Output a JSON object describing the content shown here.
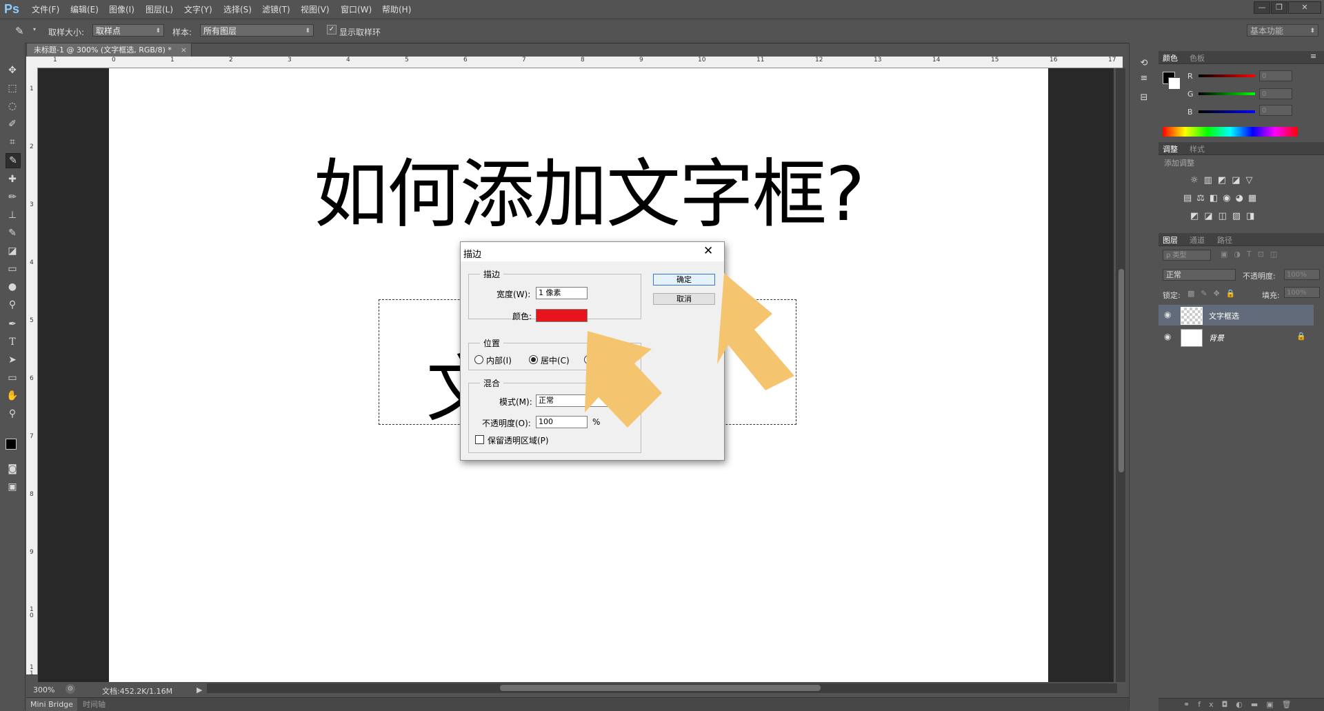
{
  "app": {
    "logo": "Ps",
    "menu": [
      "文件(F)",
      "编辑(E)",
      "图像(I)",
      "图层(L)",
      "文字(Y)",
      "选择(S)",
      "滤镜(T)",
      "视图(V)",
      "窗口(W)",
      "帮助(H)"
    ],
    "window_buttons": [
      "—",
      "❐",
      "✕"
    ]
  },
  "options": {
    "sample_size_label": "取样大小:",
    "sample_size_value": "取样点",
    "sample_label": "样本:",
    "sample_value": "所有图层",
    "show_ring_label": "显示取样环",
    "workspace": "基本功能"
  },
  "document": {
    "tab_title": "未标题-1 @ 300% (文字框选, RGB/8) *",
    "headline": "如何添加文字框?",
    "partial_char": "文",
    "ruler_top": [
      "1",
      "0",
      "1",
      "2",
      "3",
      "4",
      "5",
      "6",
      "7",
      "8",
      "9",
      "10",
      "11",
      "12",
      "13",
      "14",
      "15",
      "16",
      "17"
    ],
    "ruler_left": [
      "1",
      "2",
      "3",
      "4",
      "5",
      "6",
      "7",
      "8",
      "9",
      "1\n0",
      "1\n1"
    ]
  },
  "status": {
    "zoom": "300%",
    "doc_info": "文档:452.2K/1.16M",
    "bottom_tabs": [
      "Mini Bridge",
      "时间轴"
    ]
  },
  "dialog": {
    "title": "描边",
    "stroke_group": "描边",
    "width_label": "宽度(W):",
    "width_value": "1 像素",
    "color_label": "颜色:",
    "stroke_color": "#e8141b",
    "position_group": "位置",
    "pos_inside": "内部(I)",
    "pos_center": "居中(C)",
    "blend_group": "混合",
    "mode_label": "模式(M):",
    "mode_value": "正常",
    "opacity_label": "不透明度(O):",
    "opacity_value": "100",
    "opacity_unit": "%",
    "preserve_label": "保留透明区域(P)",
    "ok": "确定",
    "cancel": "取消"
  },
  "panels": {
    "color_tabs": [
      "颜色",
      "色板"
    ],
    "channels": [
      "R",
      "G",
      "B"
    ],
    "channel_values": [
      "0",
      "0",
      "0"
    ],
    "adjust_tabs": [
      "调整",
      "样式"
    ],
    "add_adjustment": "添加调整",
    "layers_tabs": [
      "图层",
      "通道",
      "路径"
    ],
    "kind_filter": "ρ 类型",
    "blend_mode": "正常",
    "opacity_label": "不透明度:",
    "opacity_value": "100%",
    "lock_label": "锁定:",
    "fill_label": "填充:",
    "fill_value": "100%",
    "layers": [
      {
        "name": "文字框选"
      },
      {
        "name": "背景"
      }
    ]
  },
  "annotation_color": "#f5c46e"
}
